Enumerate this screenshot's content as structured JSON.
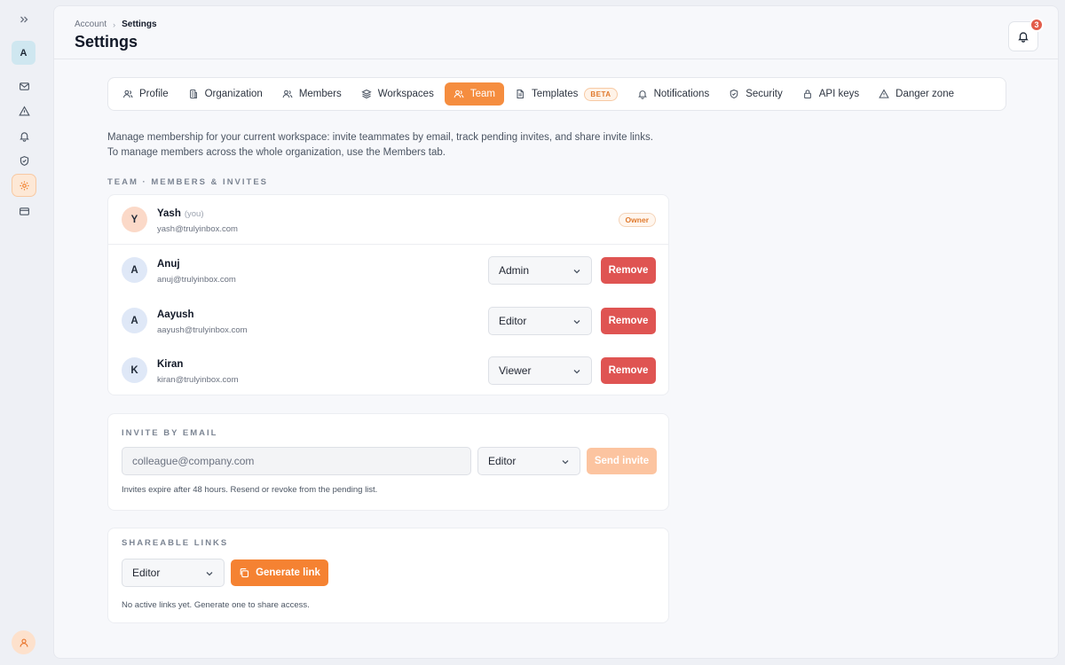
{
  "rail": {
    "avatar_initial": "A",
    "items": [
      {
        "icon": "mail-icon"
      },
      {
        "icon": "warning-icon"
      },
      {
        "icon": "bell-icon"
      },
      {
        "icon": "shield-icon"
      },
      {
        "icon": "gear-icon",
        "active": true
      },
      {
        "icon": "card-icon"
      }
    ]
  },
  "header": {
    "breadcrumb": {
      "parent": "Account",
      "current": "Settings"
    },
    "title": "Settings",
    "notification_count": "3"
  },
  "tabs": [
    {
      "label": "Profile",
      "icon": "user-icon"
    },
    {
      "label": "Organization",
      "icon": "building-icon"
    },
    {
      "label": "Members",
      "icon": "users-icon"
    },
    {
      "label": "Workspaces",
      "icon": "layers-icon"
    },
    {
      "label": "Team",
      "icon": "users-icon",
      "active": true
    },
    {
      "label": "Templates",
      "icon": "document-icon",
      "badge": "BETA"
    },
    {
      "label": "Notifications",
      "icon": "bell-icon"
    },
    {
      "label": "Security",
      "icon": "shield-icon"
    },
    {
      "label": "API keys",
      "icon": "lock-icon"
    },
    {
      "label": "Danger zone",
      "icon": "warning-icon"
    }
  ],
  "description": {
    "line1": "Manage membership for your current workspace: invite teammates by email, track pending invites, and share invite links.",
    "line2": "To manage members across the whole organization, use the Members tab."
  },
  "team": {
    "section_label": "TEAM · MEMBERS & INVITES",
    "owner": {
      "initial": "Y",
      "name": "Yash",
      "you_label": "(you)",
      "email": "yash@trulyinbox.com",
      "badge": "Owner"
    },
    "remove_label": "Remove",
    "members": [
      {
        "initial": "A",
        "name": "Anuj",
        "email": "anuj@trulyinbox.com",
        "role": "Admin"
      },
      {
        "initial": "A",
        "name": "Aayush",
        "email": "aayush@trulyinbox.com",
        "role": "Editor"
      },
      {
        "initial": "K",
        "name": "Kiran",
        "email": "kiran@trulyinbox.com",
        "role": "Viewer"
      }
    ]
  },
  "invite": {
    "section_label": "INVITE BY EMAIL",
    "email_placeholder": "colleague@company.com",
    "role": "Editor",
    "send_label": "Send invite",
    "hint": "Invites expire after 48 hours. Resend or revoke from the pending list."
  },
  "links": {
    "section_label": "SHAREABLE LINKS",
    "role": "Editor",
    "generate_label": "Generate link",
    "hint": "No active links yet. Generate one to share access."
  },
  "colors": {
    "accent": "#f58d3f",
    "danger": "#df5452"
  }
}
